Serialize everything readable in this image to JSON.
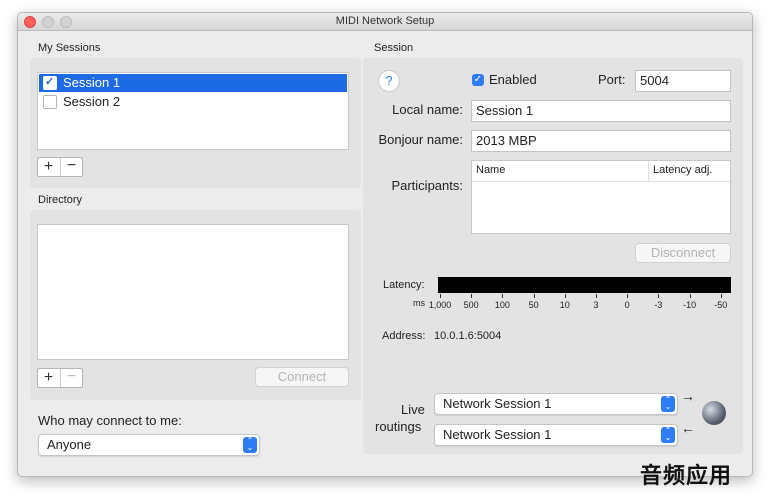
{
  "window": {
    "title": "MIDI Network Setup"
  },
  "my_sessions": {
    "header": "My Sessions",
    "items": [
      {
        "label": "Session 1",
        "checked": true,
        "selected": true
      },
      {
        "label": "Session 2",
        "checked": false,
        "selected": false
      }
    ],
    "add_symbol": "+",
    "remove_symbol": "−"
  },
  "directory": {
    "header": "Directory",
    "add_symbol": "+",
    "remove_symbol": "−",
    "connect_label": "Connect"
  },
  "who_may_connect": {
    "label": "Who may connect to me:",
    "value": "Anyone"
  },
  "session": {
    "header": "Session",
    "help_symbol": "?",
    "enabled_label": "Enabled",
    "enabled_checked": true,
    "port_label": "Port:",
    "port_value": "5004",
    "local_name_label": "Local name:",
    "local_name_value": "Session 1",
    "bonjour_name_label": "Bonjour name:",
    "bonjour_name_value": "2013 MBP",
    "participants_label": "Participants:",
    "participants_columns": [
      "Name",
      "Latency adj."
    ],
    "disconnect_label": "Disconnect",
    "latency_label": "Latency:",
    "ms_label": "ms",
    "latency_scale": [
      "1,000",
      "500",
      "100",
      "50",
      "10",
      "3",
      "0",
      "-3",
      "-10",
      "-50"
    ],
    "address_label": "Address:",
    "address_value": "10.0.1.6:5004",
    "live_label": "Live",
    "routings_label": "routings",
    "routing_1": "Network Session 1",
    "routing_2": "Network Session 1",
    "arrow_out": "→",
    "arrow_in": "←"
  },
  "watermark": "音频应用",
  "colors": {
    "selection": "#1d6ae5",
    "accent": "#2e7cf6",
    "close": "#fc605b"
  },
  "icons": [
    "close-icon",
    "minimize-icon",
    "zoom-icon",
    "help-icon",
    "checkbox-icon",
    "stepper-icon",
    "arrow-right-icon",
    "arrow-left-icon",
    "network-globe-icon"
  ]
}
